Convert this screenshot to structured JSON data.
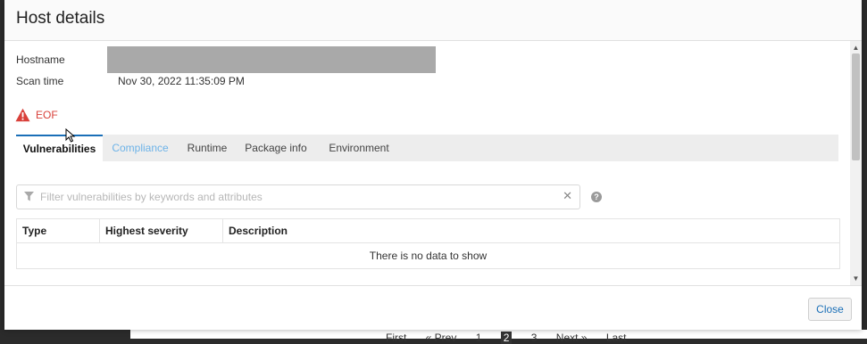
{
  "background": {
    "pager": [
      "First",
      "« Prev",
      "1",
      "2",
      "3",
      "Next »",
      "Last"
    ]
  },
  "modal": {
    "title": "Host details",
    "fields": {
      "hostname_label": "Hostname",
      "scan_time_label": "Scan time",
      "scan_time_value": "Nov 30, 2022 11:35:09 PM"
    },
    "error": {
      "icon": "warning-triangle-icon",
      "text": "EOF",
      "color": "#d9403a"
    },
    "tabs": [
      {
        "label": "Vulnerabilities",
        "active": true
      },
      {
        "label": "Compliance",
        "active": false
      },
      {
        "label": "Runtime",
        "active": false
      },
      {
        "label": "Package info",
        "active": false
      },
      {
        "label": "Environment",
        "active": false
      }
    ],
    "filter": {
      "placeholder": "Filter vulnerabilities by keywords and attributes",
      "value": "",
      "help": "?"
    },
    "table": {
      "columns": [
        "Type",
        "Highest severity",
        "Description"
      ],
      "empty_message": "There is no data to show"
    },
    "footer": {
      "close_label": "Close"
    },
    "accent_color": "#1a6fb7"
  }
}
